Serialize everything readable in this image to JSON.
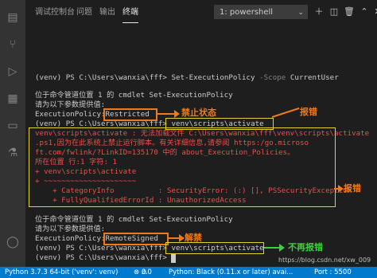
{
  "tabs": [
    {
      "label": "调试控制台"
    },
    {
      "label": "问题"
    },
    {
      "label": "输出"
    },
    {
      "label": "终端"
    }
  ],
  "terminal_select": {
    "value": "1: powershell"
  },
  "lines": [
    "(venv) PS C:\\Users\\wanxia\\fff> Set-ExecutionPolicy",
    "-Scope",
    "CurrentUser",
    "",
    "位于命令管道位置 1 的 cmdlet Set-ExecutionPolicy",
    "请为以下参数提供值:",
    "ExecutionPolicy:",
    "Restricted",
    "(venv) PS C:\\Users\\wanxia\\fff>",
    "venv\\scripts\\activate",
    "venv\\scripts\\activate : 无法加载文件 C:\\Users\\wanxia\\fff\\venv\\scripts\\activate.ps1,因为在此系统上禁止运行脚本。有关详细信息,请参阅 https:/go.microsoft.com/fwlink/?LinkID=135170 中的 about_Execution_Policies。",
    "所在位置 行:1 字符: 1",
    "+ venv\\scripts\\activate",
    "+ ~~~~~~~~~~~~~~~~~~~~~",
    "    + CategoryInfo          : SecurityError: (:) [], PSSecurityException",
    "    + FullyQualifiedErrorId : UnauthorizedAccess",
    "",
    "位于命令管道位置 1 的 cmdlet Set-ExecutionPolicy",
    "请为以下参数提供值:",
    "ExecutionPolicy:",
    "RemoteSigned",
    "(venv) PS C:\\Users\\wanxia\\fff>",
    "venv\\scripts\\activate",
    "(venv) PS C:\\Users\\wanxia\\fff>"
  ],
  "error_lines": [
    "venv\\scripts\\activate : 无法加载文件 C:\\Users\\wanxia\\fff\\venv\\scripts\\activate",
    ".ps1,因为在此系统上禁止运行脚本。有关详细信息,请参阅 https:/go.microso",
    "ft.com/fwlink/?LinkID=135170 中的 about_Execution_Policies。",
    "所在位置 行:1 字符: 1",
    "+ venv\\scripts\\activate",
    "+ ~~~~~~~~~~~~~~~~~~~~~"
  ],
  "annotations": {
    "disabled": "禁止状态",
    "error": "报错",
    "unblock": "解禁",
    "no_error": "不再报错"
  },
  "statusbar": {
    "python": "Python 3.7.3 64-bit ('venv': venv)",
    "errors": "0",
    "warnings": "0",
    "black": "Python: Black (0.11.x or later) avai...",
    "port": "Port : 5500"
  },
  "watermark": "https://blog.csdn.net/xw_009",
  "colors": {
    "statusbar": "#007acc",
    "error_text": "#f14c4c",
    "annotation_orange": "#f07a1a",
    "annotation_green": "#3cd23c",
    "box_yellow": "#e2d22c"
  }
}
